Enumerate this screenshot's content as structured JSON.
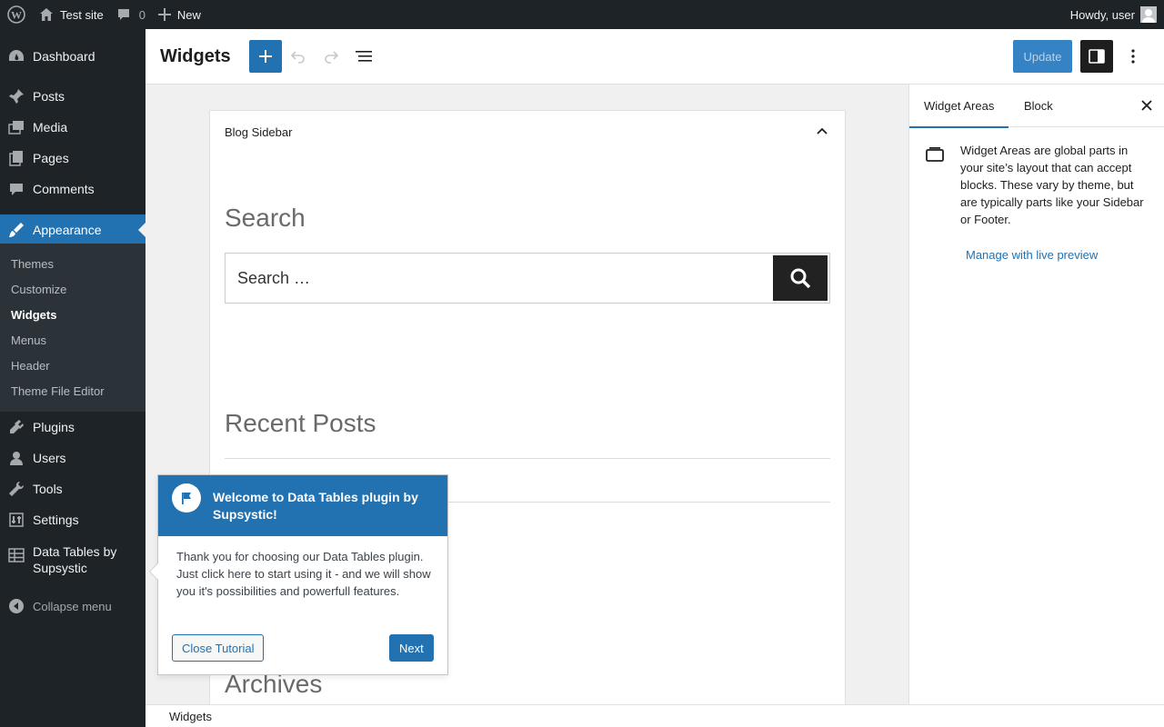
{
  "admin_bar": {
    "site_name": "Test site",
    "comments_count": "0",
    "new_label": "New",
    "greeting": "Howdy, user"
  },
  "menu": {
    "items": [
      {
        "label": "Dashboard",
        "icon": "dashboard-icon"
      },
      {
        "label": "Posts",
        "icon": "pin-icon"
      },
      {
        "label": "Media",
        "icon": "media-icon"
      },
      {
        "label": "Pages",
        "icon": "pages-icon"
      },
      {
        "label": "Comments",
        "icon": "comment-icon"
      },
      {
        "label": "Appearance",
        "icon": "brush-icon"
      },
      {
        "label": "Plugins",
        "icon": "plug-icon"
      },
      {
        "label": "Users",
        "icon": "user-icon"
      },
      {
        "label": "Tools",
        "icon": "wrench-icon"
      },
      {
        "label": "Settings",
        "icon": "settings-icon"
      },
      {
        "label": "Data Tables by Supsystic",
        "icon": "table-icon"
      }
    ],
    "submenu": [
      "Themes",
      "Customize",
      "Widgets",
      "Menus",
      "Header",
      "Theme File Editor"
    ],
    "collapse_label": "Collapse menu"
  },
  "editor": {
    "title": "Widgets",
    "update_label": "Update"
  },
  "canvas": {
    "area_title": "Blog Sidebar",
    "search_heading": "Search",
    "search_placeholder": "Search …",
    "recent_heading": "Recent Posts",
    "archives_heading": "Archives"
  },
  "sidebar": {
    "tab_areas": "Widget Areas",
    "tab_block": "Block",
    "description": "Widget Areas are global parts in your site’s layout that can accept blocks. These vary by theme, but are typically parts like your Sidebar or Footer.",
    "link": "Manage with live preview"
  },
  "footer": {
    "breadcrumb": "Widgets"
  },
  "tutorial": {
    "title": "Welcome to Data Tables plugin by Supsystic!",
    "body": "Thank you for choosing our Data Tables plugin. Just click here to start using it - and we will show you it's possibilities and powerfull features.",
    "close_label": "Close Tutorial",
    "next_label": "Next"
  },
  "colors": {
    "accent": "#2271b1",
    "admin_bg": "#1d2327",
    "submenu_bg": "#2c3338"
  }
}
